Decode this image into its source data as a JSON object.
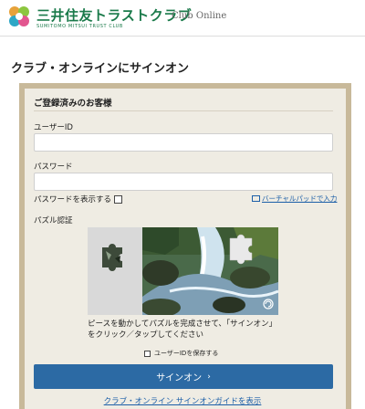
{
  "header": {
    "logo_main": "三井住友トラストクラブ",
    "logo_sub": "SUMITOMO MITSUI TRUST CLUB",
    "logo_club": "Club Online"
  },
  "page": {
    "title": "クラブ・オンラインにサインオン"
  },
  "form": {
    "section_title": "ご登録済みのお客様",
    "user_id_label": "ユーザーID",
    "user_id_value": "",
    "password_label": "パスワード",
    "password_value": "",
    "show_password_label": "パスワードを表示する",
    "show_password_checked": false,
    "virtual_keypad_link": "バーチャルパッドで入力",
    "puzzle_label": "パズル認証",
    "puzzle_instructions": "ピースを動かしてパズルを完成させて、「サインオン」をクリック／タップしてください",
    "save_id_label": "ユーザーIDを保存する",
    "save_id_checked": false,
    "signon_button": "サインオン",
    "guide_link": "クラブ・オンライン サインオンガイドを表示"
  },
  "colors": {
    "brand_green": "#1a7a4a",
    "panel_border": "#c8b99a",
    "panel_bg": "#efece3",
    "button_bg": "#2c6aa4",
    "link": "#1c5fa8"
  }
}
